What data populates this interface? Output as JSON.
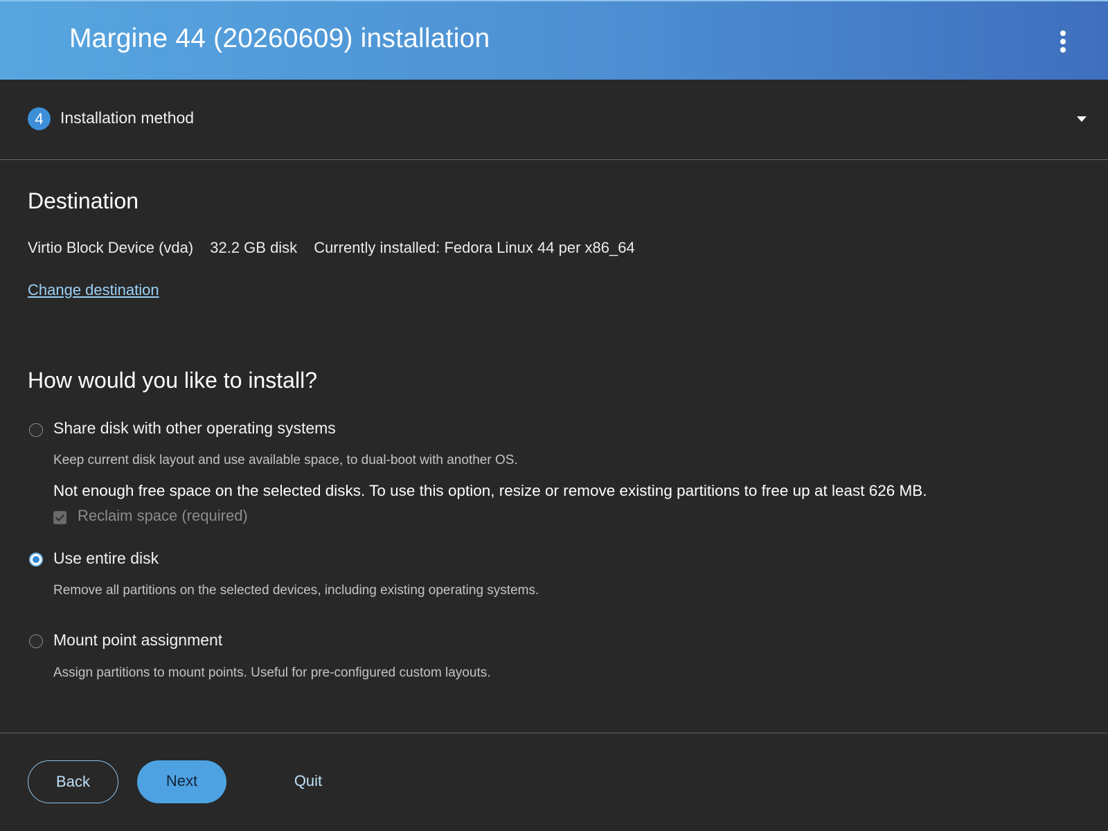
{
  "header": {
    "title": "Margine 44 (20260609) installation",
    "menu_icon": "kebab-vertical-icon"
  },
  "step": {
    "number": "4",
    "label": "Installation method",
    "toggle_icon": "caret-down-icon"
  },
  "destination": {
    "title": "Destination",
    "device": "Virtio Block Device (vda)",
    "size": "32.2 GB disk",
    "installed": "Currently installed: Fedora Linux 44 per x86_64",
    "change_link": "Change destination"
  },
  "install": {
    "title": "How would you like to install?",
    "options": [
      {
        "label": "Share disk with other operating systems",
        "description": "Keep current disk layout and use available space, to dual-boot with another OS.",
        "selected": false,
        "warning": "Not enough free space on the selected disks. To use this option, resize or remove existing partitions to free up at least 626 MB.",
        "checkbox_label": "Reclaim space (required)",
        "checkbox_checked": true,
        "checkbox_disabled": true
      },
      {
        "label": "Use entire disk",
        "description": "Remove all partitions on the selected devices, including existing operating systems.",
        "selected": true
      },
      {
        "label": "Mount point assignment",
        "description": "Assign partitions to mount points. Useful for pre-configured custom layouts.",
        "selected": false
      }
    ]
  },
  "footer": {
    "back": "Back",
    "next": "Next",
    "quit": "Quit"
  },
  "colors": {
    "accent": "#4ea2e2",
    "background": "#282828",
    "link": "#9bd0f5"
  }
}
